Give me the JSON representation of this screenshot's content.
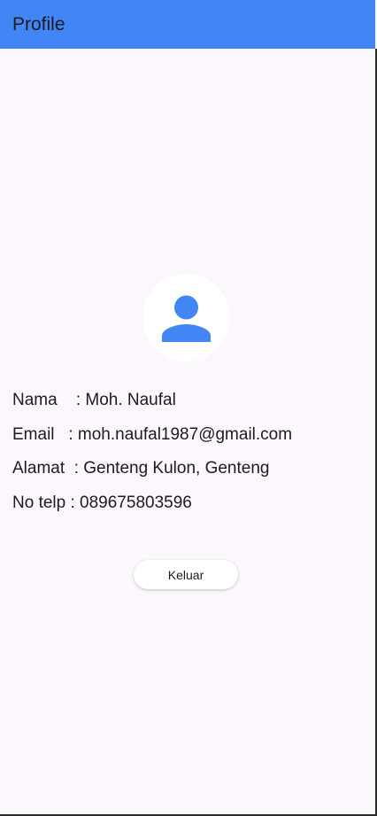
{
  "app_bar": {
    "title": "Profile",
    "color": "#4285f4"
  },
  "avatar": {
    "icon": "person-icon",
    "color": "#4285f4"
  },
  "profile": {
    "nama": {
      "label": "Nama    ",
      "value": ": Moh. Naufal"
    },
    "email": {
      "label": "Email   ",
      "value": ": moh.naufal1987@gmail.com"
    },
    "alamat": {
      "label": "Alamat  ",
      "value": ": Genteng Kulon, Genteng"
    },
    "telp": {
      "label": "No telp ",
      "value": ": 089675803596"
    }
  },
  "actions": {
    "logout_label": "Keluar"
  }
}
